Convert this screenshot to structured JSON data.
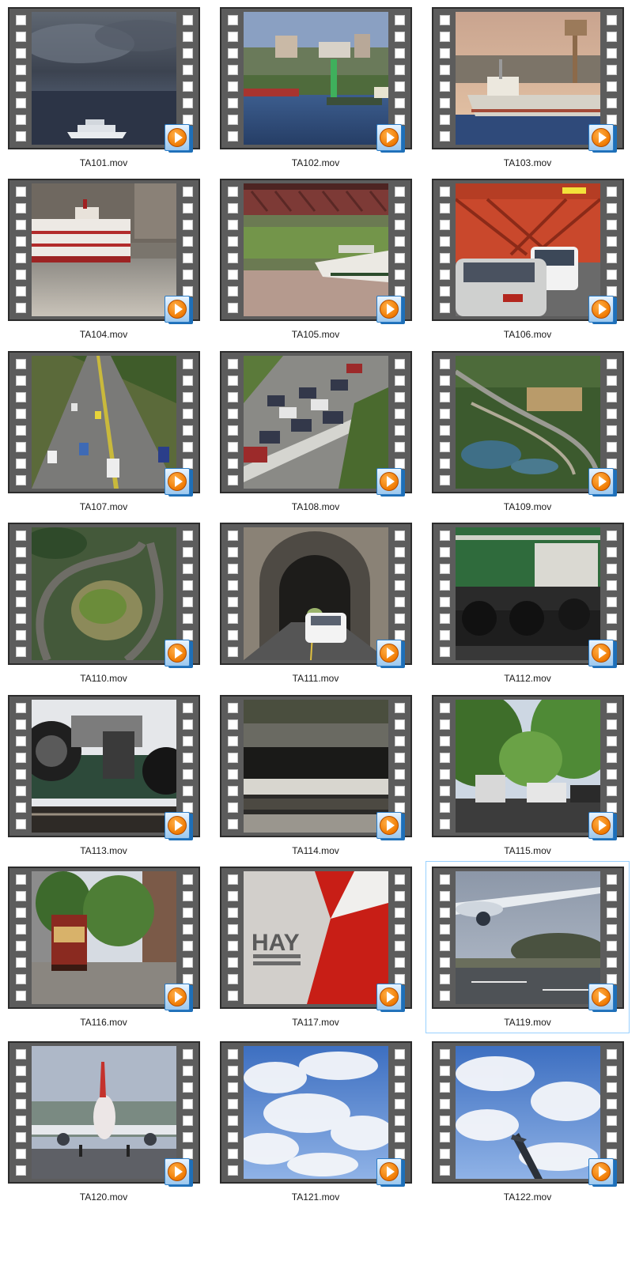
{
  "files": [
    {
      "name": "TA101.mov",
      "thumbnail": "ferry-in-storm-thumbnail"
    },
    {
      "name": "TA102.mov",
      "thumbnail": "city-waterfront-thumbnail"
    },
    {
      "name": "TA103.mov",
      "thumbnail": "cargo-ship-thumbnail"
    },
    {
      "name": "TA104.mov",
      "thumbnail": "sternwheeler-thumbnail"
    },
    {
      "name": "TA105.mov",
      "thumbnail": "bridge-boat-thumbnail"
    },
    {
      "name": "TA106.mov",
      "thumbnail": "bridge-traffic-thumbnail"
    },
    {
      "name": "TA107.mov",
      "thumbnail": "highway-thumbnail"
    },
    {
      "name": "TA108.mov",
      "thumbnail": "traffic-jam-thumbnail"
    },
    {
      "name": "TA109.mov",
      "thumbnail": "winding-road-aerial-thumbnail"
    },
    {
      "name": "TA110.mov",
      "thumbnail": "hairpin-road-thumbnail"
    },
    {
      "name": "TA111.mov",
      "thumbnail": "tunnel-car-thumbnail"
    },
    {
      "name": "TA112.mov",
      "thumbnail": "train-locomotive-thumbnail"
    },
    {
      "name": "TA113.mov",
      "thumbnail": "train-coupling-thumbnail"
    },
    {
      "name": "TA114.mov",
      "thumbnail": "train-blur-thumbnail"
    },
    {
      "name": "TA115.mov",
      "thumbnail": "tree-lined-street-thumbnail"
    },
    {
      "name": "TA116.mov",
      "thumbnail": "streetcar-thumbnail"
    },
    {
      "name": "TA117.mov",
      "thumbnail": "truck-closeup-thumbnail"
    },
    {
      "name": "TA119.mov",
      "thumbnail": "plane-takeoff-thumbnail",
      "selected": true
    },
    {
      "name": "TA120.mov",
      "thumbnail": "plane-landing-thumbnail"
    },
    {
      "name": "TA121.mov",
      "thumbnail": "clouds-thumbnail"
    },
    {
      "name": "TA122.mov",
      "thumbnail": "plane-in-sky-thumbnail"
    }
  ],
  "icons": {
    "play_badge": "media-player-play-icon"
  },
  "colors": {
    "film_strip": "#5c5c5c",
    "selection_border": "#99d1ff",
    "play_orange": "#f07a00",
    "badge_blue": "#2b7cc6"
  }
}
